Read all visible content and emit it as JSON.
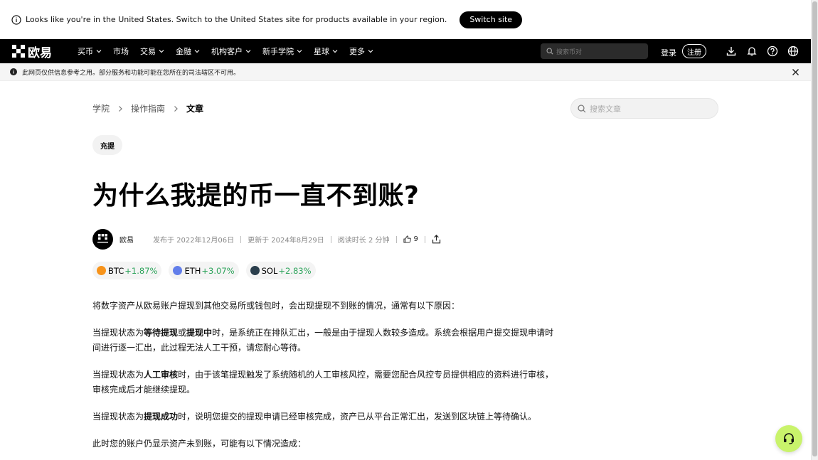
{
  "region_banner": {
    "message": "Looks like you're in the United States. Switch to the United States site for products available in your region.",
    "switch_label": "Switch site"
  },
  "topnav": {
    "logo_text": "欧易",
    "items": [
      {
        "label": "买币",
        "dropdown": true
      },
      {
        "label": "市场",
        "dropdown": false
      },
      {
        "label": "交易",
        "dropdown": true
      },
      {
        "label": "金融",
        "dropdown": true
      },
      {
        "label": "机构客户",
        "dropdown": true
      },
      {
        "label": "新手学院",
        "dropdown": true
      },
      {
        "label": "星球",
        "dropdown": true
      },
      {
        "label": "更多",
        "dropdown": true
      }
    ],
    "search_placeholder": "搜索币对",
    "login_label": "登录",
    "register_label": "注册"
  },
  "disclaimer": {
    "text": "此网页仅供信息参考之用。部分服务和功能可能在您所在的司法辖区不可用。"
  },
  "breadcrumb": [
    {
      "label": "学院"
    },
    {
      "label": "操作指南"
    },
    {
      "label": "文章"
    }
  ],
  "article_search_placeholder": "搜索文章",
  "article": {
    "tag": "充提",
    "title": "为什么我提的币一直不到账?",
    "author": "欧易",
    "published": "发布于 2022年12月06日",
    "updated": "更新于 2024年8月29日",
    "read_time": "阅读时长 2 分钟",
    "likes": "9",
    "tickers": [
      {
        "symbol": "BTC",
        "change": "+1.87%",
        "color": "#f7931a"
      },
      {
        "symbol": "ETH",
        "change": "+3.07%",
        "color": "#627eea"
      },
      {
        "symbol": "SOL",
        "change": "+2.83%",
        "color": "#2a3e4c"
      }
    ],
    "paragraphs": {
      "p1": "将数字资产从欧易账户提现到其他交易所或钱包时，会出现提现不到账的情况，通常有以下原因：",
      "p2_a": "当提现状态为",
      "p2_b1": "等待提现",
      "p2_or": "或",
      "p2_b2": "提现中",
      "p2_c": "时，是系统正在排队汇出，一般是由于提现人数较多造成。系统会根据用户提交提现申请时间进行逐一汇出，此过程无法人工干预，请您耐心等待。",
      "p3_a": "当提现状态为",
      "p3_b": "人工审核",
      "p3_c": "时，由于该笔提现触发了系统随机的人工审核风控，需要您配合风控专员提供相应的资料进行审核，审核完成后才能继续提现。",
      "p4_a": "当提现状态为",
      "p4_b": "提现成功",
      "p4_c": "时，说明您提交的提现申请已经审核完成，资产已从平台正常汇出，发送到区块链上等待确认。",
      "p5": "此时您的账户仍显示资产未到账，可能有以下情况造成："
    }
  },
  "colors": {
    "accent_green": "#2ca35a",
    "support_button": "#c9f36b"
  }
}
